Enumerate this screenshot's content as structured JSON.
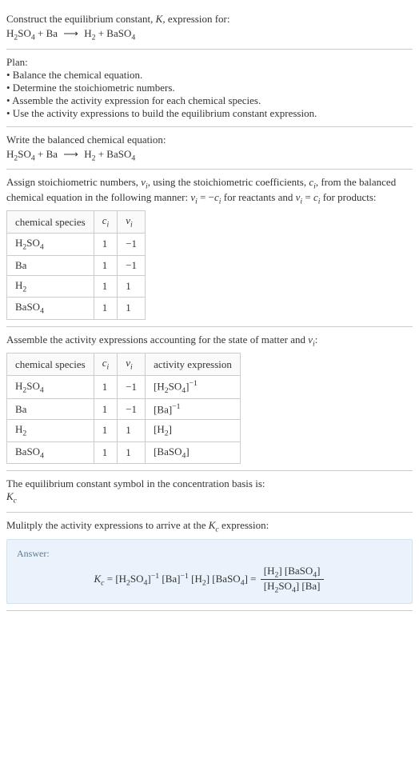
{
  "intro": {
    "line1": "Construct the equilibrium constant, K, expression for:",
    "equation": "H₂SO₄ + Ba ⟶ H₂ + BaSO₄"
  },
  "plan": {
    "header": "Plan:",
    "items": [
      "• Balance the chemical equation.",
      "• Determine the stoichiometric numbers.",
      "• Assemble the activity expression for each chemical species.",
      "• Use the activity expressions to build the equilibrium constant expression."
    ]
  },
  "balanced": {
    "header": "Write the balanced chemical equation:",
    "equation": "H₂SO₄ + Ba ⟶ H₂ + BaSO₄"
  },
  "stoich": {
    "header": "Assign stoichiometric numbers, νᵢ, using the stoichiometric coefficients, cᵢ, from the balanced chemical equation in the following manner: νᵢ = −cᵢ for reactants and νᵢ = cᵢ for products:",
    "cols": [
      "chemical species",
      "cᵢ",
      "νᵢ"
    ],
    "rows": [
      {
        "species": "H₂SO₄",
        "c": "1",
        "v": "−1"
      },
      {
        "species": "Ba",
        "c": "1",
        "v": "−1"
      },
      {
        "species": "H₂",
        "c": "1",
        "v": "1"
      },
      {
        "species": "BaSO₄",
        "c": "1",
        "v": "1"
      }
    ]
  },
  "activity": {
    "header": "Assemble the activity expressions accounting for the state of matter and νᵢ:",
    "cols": [
      "chemical species",
      "cᵢ",
      "νᵢ",
      "activity expression"
    ],
    "rows": [
      {
        "species": "H₂SO₄",
        "c": "1",
        "v": "−1",
        "expr": "[H₂SO₄]⁻¹"
      },
      {
        "species": "Ba",
        "c": "1",
        "v": "−1",
        "expr": "[Ba]⁻¹"
      },
      {
        "species": "H₂",
        "c": "1",
        "v": "1",
        "expr": "[H₂]"
      },
      {
        "species": "BaSO₄",
        "c": "1",
        "v": "1",
        "expr": "[BaSO₄]"
      }
    ]
  },
  "symbol": {
    "line1": "The equilibrium constant symbol in the concentration basis is:",
    "line2": "K_c"
  },
  "multiply": {
    "header": "Mulitply the activity expressions to arrive at the K_c expression:"
  },
  "answer": {
    "label": "Answer:",
    "lhs": "K_c = [H₂SO₄]⁻¹ [Ba]⁻¹ [H₂] [BaSO₄] = ",
    "num": "[H₂] [BaSO₄]",
    "den": "[H₂SO₄] [Ba]"
  }
}
